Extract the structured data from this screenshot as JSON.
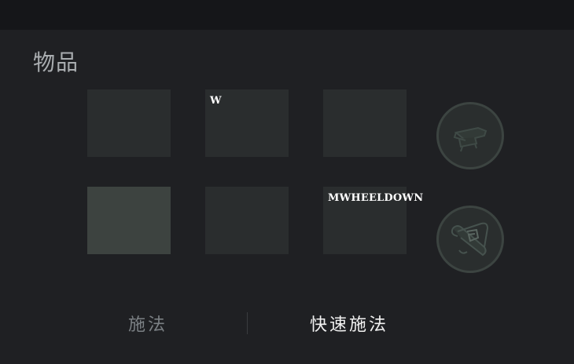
{
  "section": {
    "title": "物品"
  },
  "slots": [
    {
      "hotkey": "",
      "highlighted": false
    },
    {
      "hotkey": "W",
      "highlighted": false
    },
    {
      "hotkey": "",
      "highlighted": false
    },
    {
      "hotkey": "",
      "highlighted": true
    },
    {
      "hotkey": "",
      "highlighted": false
    },
    {
      "hotkey": "MWHEELDOWN",
      "highlighted": false
    }
  ],
  "neutral_slots": [
    {
      "icon": "anvil-icon"
    },
    {
      "icon": "scroll-icon"
    }
  ],
  "tabs": {
    "cast": "施法",
    "quick_cast": "快速施法",
    "active": "quick_cast"
  },
  "colors": {
    "background": "#1f2023",
    "topbar": "#151619",
    "slot": "#2a2d2e",
    "slot_highlight": "#3d4340",
    "tab_active": "#f2f2f2",
    "tab_inactive": "#7b8084"
  }
}
